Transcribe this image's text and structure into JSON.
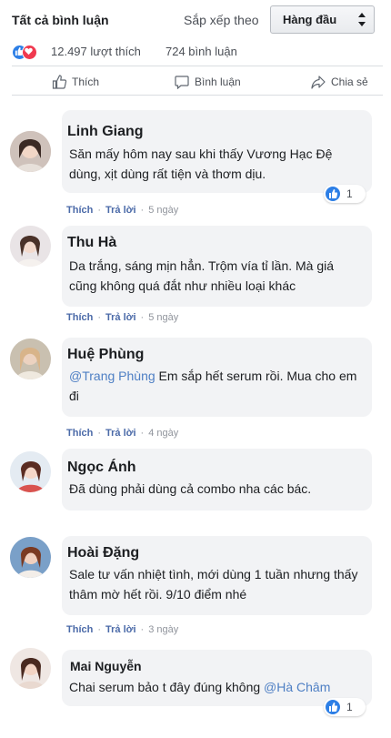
{
  "header": {
    "title": "Tất cả bình luận",
    "sort_label": "Sắp xếp theo",
    "sort_value": "Hàng đầu"
  },
  "stats": {
    "likes": "12.497 lượt thích",
    "comments": "724 bình luận"
  },
  "actions": {
    "like": "Thích",
    "comment": "Bình luận",
    "share": "Chia sẻ"
  },
  "comments": [
    {
      "name": "Linh Giang",
      "text": "Săn mấy hôm nay sau khi thấy Vương Hạc Đệ dùng, xịt dùng rất tiện và thơm dịu.",
      "like": "Thích",
      "reply": "Trả lời",
      "time": "5 ngày",
      "reactions": "1"
    },
    {
      "name": "Thu Hà",
      "text": "Da trắng, sáng mịn hẳn. Trộm vía tỉ lần. Mà giá cũng không quá đắt như nhiều loại khác",
      "like": "Thích",
      "reply": "Trả lời",
      "time": "5 ngày"
    },
    {
      "name": "Huệ Phùng",
      "mention": "@Trang Phùng",
      "text": " Em sắp hết serum rồi. Mua cho em đi",
      "like": "Thích",
      "reply": "Trả lời",
      "time": "4 ngày"
    },
    {
      "name": "Ngọc Ánh",
      "text": "Đã dùng phải dùng cả combo nha các bác."
    },
    {
      "name": "Hoài Đặng",
      "text": "Sale tư vấn nhiệt tình, mới dùng 1 tuần nhưng thấy thâm mờ hết rồi. 9/10 điểm nhé",
      "like": "Thích",
      "reply": "Trả lời",
      "time": "3 ngày"
    },
    {
      "name": "Mai Nguyễn",
      "text": "Chai serum bảo t đây đúng không ",
      "mention": "@Hà Châm",
      "reactions": "1"
    }
  ],
  "colors": {
    "accent": "#4b6aa8",
    "bubble": "#f2f3f5",
    "like_blue": "#2d7fe6",
    "love_red": "#f0394f"
  }
}
